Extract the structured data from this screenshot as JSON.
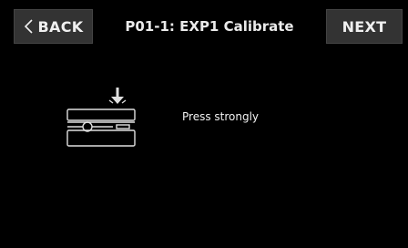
{
  "header": {
    "back_label": "BACK",
    "title": "P01-1: EXP1 Calibrate",
    "next_label": "NEXT"
  },
  "main": {
    "instruction": "Press strongly",
    "illustration_icon": "expression-pedal-press-icon"
  },
  "colors": {
    "background": "#000000",
    "button_bg": "#333333",
    "text": "#f2f2f2",
    "line_art": "#e0e0e0"
  }
}
